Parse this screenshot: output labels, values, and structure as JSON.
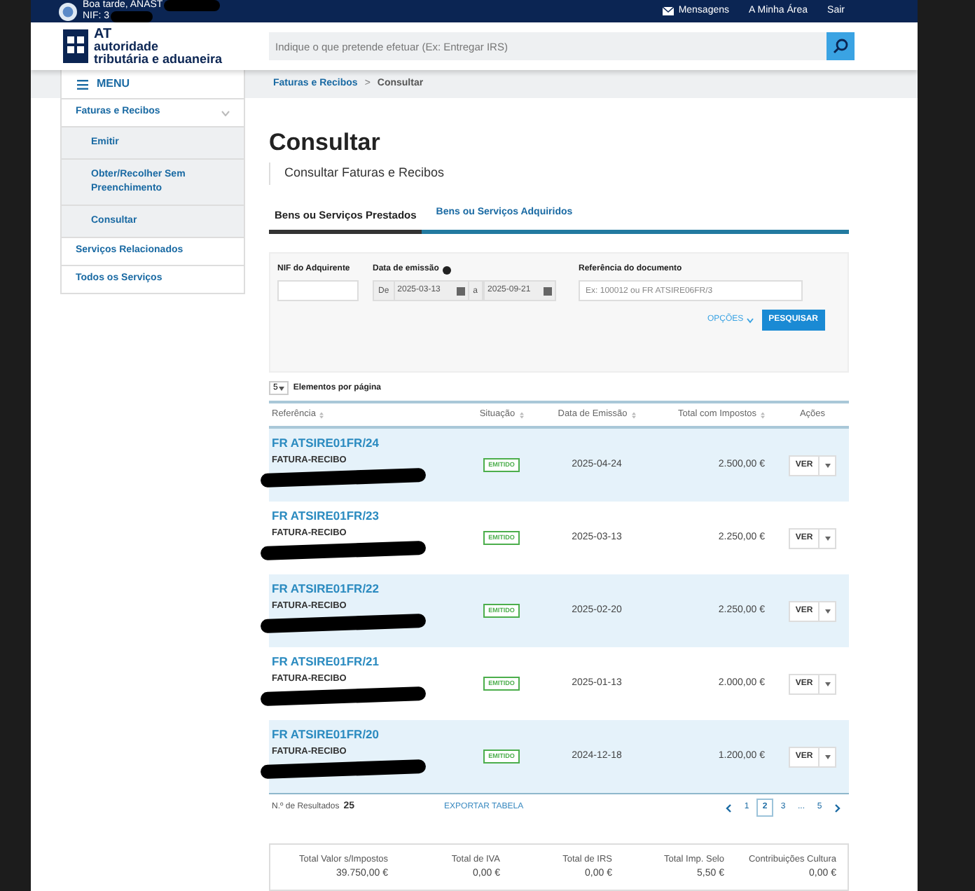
{
  "top_bar": {
    "greeting": "Boa tarde, ANAST",
    "nif": "NIF: 3",
    "links": [
      "Mensagens",
      "A Minha Área",
      "Sair"
    ]
  },
  "header": {
    "logo_short": "AT",
    "logo_line1": "autoridade",
    "logo_line2": "tributária e aduaneira",
    "search": {
      "placeholder": "Indique o que pretende efetuar (Ex: Entregar IRS)"
    }
  },
  "menu_label": "MENU",
  "breadcrumb": {
    "link": "Faturas e Recibos",
    "separator": ">",
    "current": "Consultar"
  },
  "sidebar": {
    "items": [
      {
        "label": "Faturas e Recibos",
        "expanded": true,
        "children": [
          {
            "label": "Emitir"
          },
          {
            "label": "Obter/Recolher Sem Preenchimento"
          },
          {
            "label": "Consultar"
          }
        ]
      },
      {
        "label": "Serviços Relacionados"
      },
      {
        "label": "Todos os Serviços"
      }
    ]
  },
  "title": "Consultar",
  "subtitle": "Consultar Faturas e Recibos",
  "tabs": [
    {
      "label": "Bens ou Serviços Prestados",
      "selected": true
    },
    {
      "label": "Bens ou Serviços Adquiridos",
      "selected": false
    }
  ],
  "filters": {
    "nif_label": "NIF do Adquirente",
    "date_label": "Data de emissão",
    "from_label": "De",
    "from": "2025-03-13",
    "to_label": "a",
    "to": "2025-09-21",
    "ref_label": "Referência do documento",
    "ref_placeholder": "Ex: 100012 ou FR ATSIRE06FR/3",
    "options": "OPÇÕES",
    "search_button": "PESQUISAR"
  },
  "page_size": {
    "value": "5",
    "label": "Elementos por página"
  },
  "table": {
    "columns": [
      "Referência",
      "Situação",
      "Data de Emissão",
      "Total com Impostos",
      "Ações"
    ],
    "rows": [
      {
        "reference": "FR ATSIRE01FR/24",
        "type": "FATURA-RECIBO",
        "status": "EMITIDO",
        "date": "2025-04-24",
        "total": "2.500,00 €",
        "action": "VER"
      },
      {
        "reference": "FR ATSIRE01FR/23",
        "type": "FATURA-RECIBO",
        "status": "EMITIDO",
        "date": "2025-03-13",
        "total": "2.250,00 €",
        "action": "VER"
      },
      {
        "reference": "FR ATSIRE01FR/22",
        "type": "FATURA-RECIBO",
        "status": "EMITIDO",
        "date": "2025-02-20",
        "total": "2.250,00 €",
        "action": "VER"
      },
      {
        "reference": "FR ATSIRE01FR/21",
        "type": "FATURA-RECIBO",
        "status": "EMITIDO",
        "date": "2025-01-13",
        "total": "2.000,00 €",
        "action": "VER"
      },
      {
        "reference": "FR ATSIRE01FR/20",
        "type": "FATURA-RECIBO",
        "status": "EMITIDO",
        "date": "2024-12-18",
        "total": "1.200,00 €",
        "action": "VER"
      }
    ]
  },
  "results": {
    "label": "N.º de Resultados",
    "count": "25",
    "export": "EXPORTAR TABELA"
  },
  "pagination": [
    {
      "label": "1",
      "selected": false
    },
    {
      "label": "2",
      "selected": true
    },
    {
      "label": "3",
      "selected": false
    },
    {
      "label": "...",
      "selected": false
    },
    {
      "label": "5",
      "selected": false
    }
  ],
  "totals": [
    {
      "label": "Total Valor s/Impostos",
      "value": "39.750,00 €"
    },
    {
      "label": "Total de IVA",
      "value": "0,00 €"
    },
    {
      "label": "Total de IRS",
      "value": "0,00 €"
    },
    {
      "label": "Total Imp. Selo",
      "value": "5,50 €"
    },
    {
      "label": "Contribuições Cultura",
      "value": "0,00 €"
    }
  ]
}
